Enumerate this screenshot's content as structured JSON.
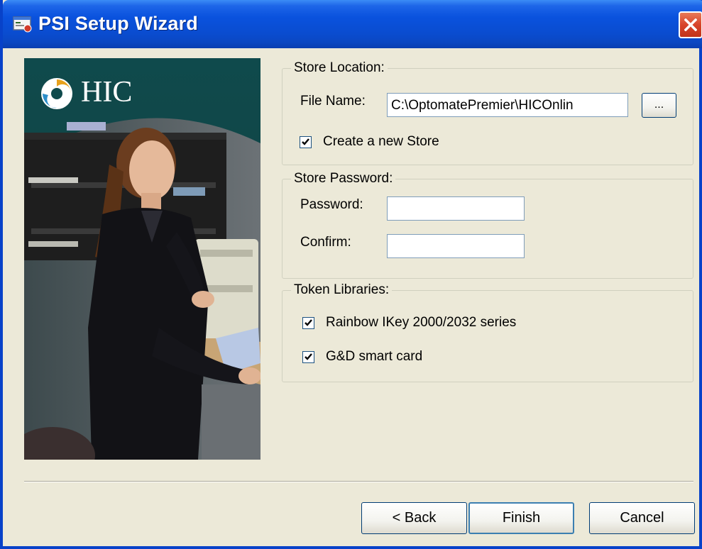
{
  "window": {
    "title": "PSI Setup Wizard",
    "icon": "wizard-app-icon",
    "close_icon": "close-icon"
  },
  "brand": {
    "logo_text": "HIC"
  },
  "store_location": {
    "legend": "Store Location:",
    "file_name_label": "File Name:",
    "file_name_value": "C:\\OptomatePremier\\HICOnlin",
    "browse_label": "...",
    "create_new_store_label": "Create a new Store",
    "create_new_store_checked": true
  },
  "store_password": {
    "legend": "Store Password:",
    "password_label": "Password:",
    "password_value": "",
    "confirm_label": "Confirm:",
    "confirm_value": ""
  },
  "token_libraries": {
    "legend": "Token Libraries:",
    "items": [
      {
        "label": "Rainbow IKey 2000/2032 series",
        "checked": true
      },
      {
        "label": "G&D smart card",
        "checked": true
      }
    ]
  },
  "buttons": {
    "back": "< Back",
    "finish": "Finish",
    "cancel": "Cancel"
  },
  "colors": {
    "titlebar": "#0a4ccf",
    "dialog_bg": "#ece9d8",
    "close_button": "#d8442b"
  }
}
